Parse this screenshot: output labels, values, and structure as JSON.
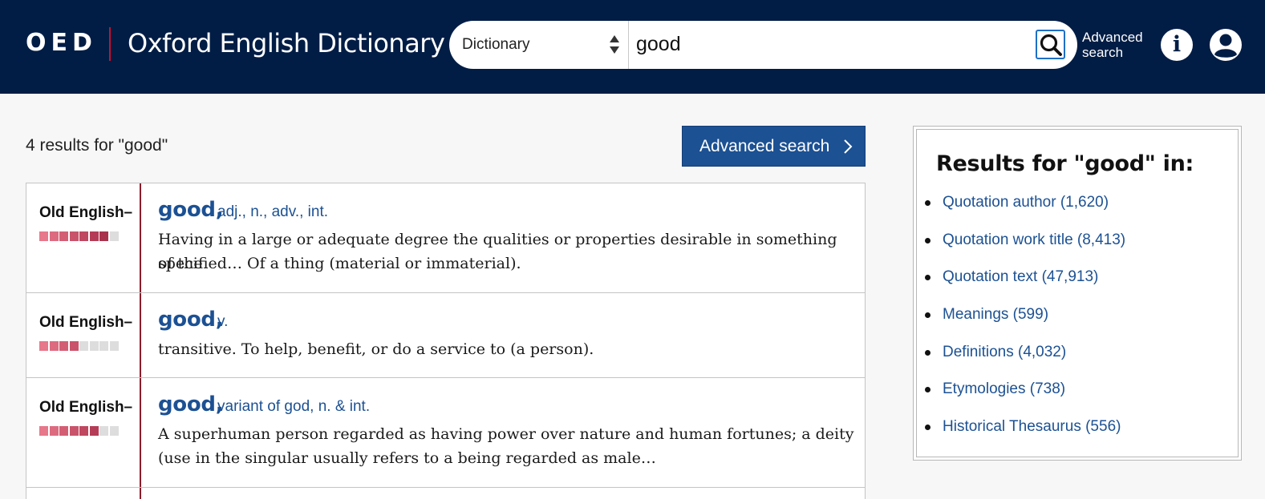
{
  "header": {
    "logo_abbr": "OED",
    "logo_name": "Oxford English Dictionary",
    "search": {
      "scope": "Dictionary",
      "query": "good"
    },
    "advanced_link": "Advanced search",
    "info_label": "i"
  },
  "main": {
    "results_count": "4 results for \"good\"",
    "advanced_button": "Advanced search",
    "results": [
      {
        "date": "Old English–",
        "frequency": 7,
        "headword": "good,",
        "pos": "adj., n., adv., int.",
        "definition_line1": "Having in a large or adequate degree the qualities or properties desirable in something of the",
        "definition_line2": "specified… Of a thing (material or immaterial)."
      },
      {
        "date": "Old English–",
        "frequency": 4,
        "headword": "good,",
        "pos": "v.",
        "definition_line1": "transitive. To help, benefit, or do a service to (a person).",
        "definition_line2": ""
      },
      {
        "date": "Old English–",
        "frequency": 6,
        "headword": "good,",
        "pos": "variant of god, n. & int.",
        "definition_line1": "A superhuman person regarded as having power over nature and human fortunes; a deity",
        "definition_line2": "(use in the singular usually refers to a being regarded as male…"
      }
    ]
  },
  "sidebar": {
    "title": "Results for \"good\" in:",
    "items": [
      "Quotation author (1,620)",
      "Quotation work title (8,413)",
      "Quotation text (47,913)",
      "Meanings (599)",
      "Definitions (4,032)",
      "Etymologies (738)",
      "Historical Thesaurus (556)"
    ]
  },
  "colors": {
    "header_bg": "#021d45",
    "accent_blue": "#1c5193",
    "date_rule": "#8b1d2c",
    "freq_fill": [
      "#e7778a",
      "#dd6b80",
      "#d35e74",
      "#c9536a",
      "#bf4760",
      "#b53c56",
      "#a8324c",
      "#9b2a44"
    ],
    "freq_empty": "#dddddd"
  },
  "icons": {
    "search": "magnifier-icon",
    "select_arrows": "sort-arrows-icon",
    "info": "info-icon",
    "account": "user-account-icon",
    "chevron": "chevron-right-icon"
  }
}
